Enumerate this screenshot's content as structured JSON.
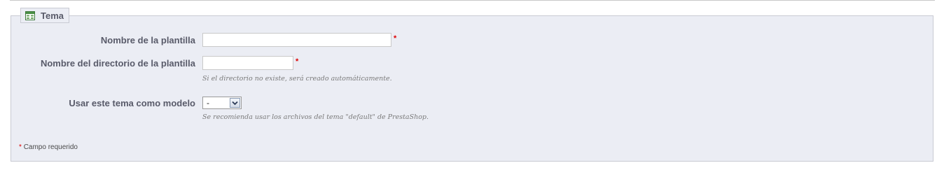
{
  "section": {
    "title": "Tema",
    "icon": "table-icon"
  },
  "fields": {
    "template_name": {
      "label": "Nombre de la plantilla",
      "value": "",
      "required_mark": "*"
    },
    "template_dir": {
      "label": "Nombre del directorio de la plantilla",
      "value": "",
      "required_mark": "*",
      "hint": "Si el directorio no existe, será creado automáticamente."
    },
    "model_theme": {
      "label": "Usar este tema como modelo",
      "selected": "-",
      "hint": "Se recomienda usar los archivos del tema \"default\" de PrestaShop."
    }
  },
  "footer": {
    "required_star": "*",
    "required_text": "Campo requerido"
  },
  "colors": {
    "panel_bg": "#ebedf4",
    "label_text": "#585a69",
    "required": "#dd0000"
  }
}
